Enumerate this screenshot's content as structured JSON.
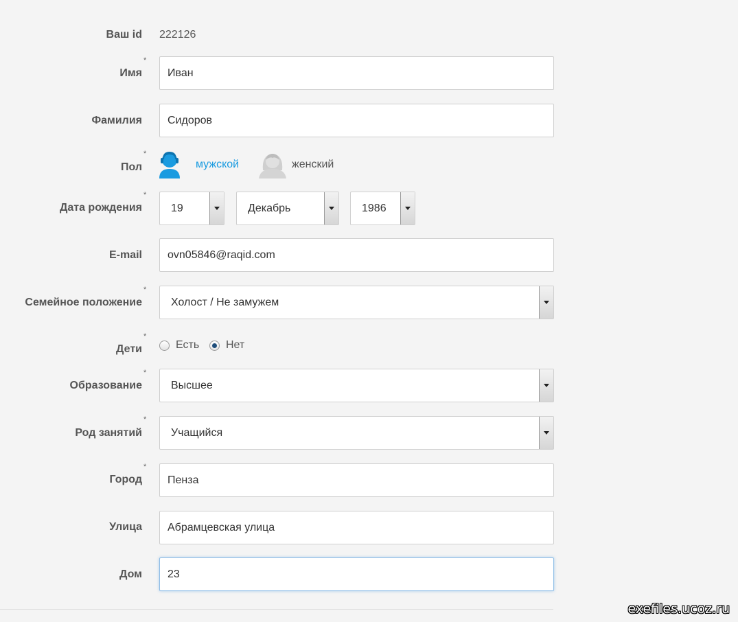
{
  "form": {
    "id_label": "Ваш id",
    "id_value": "222126",
    "first_name": {
      "label": "Имя",
      "value": "Иван",
      "required": "*"
    },
    "last_name": {
      "label": "Фамилия",
      "value": "Сидоров"
    },
    "gender": {
      "label": "Пол",
      "required": "*",
      "male_label": "мужской",
      "female_label": "женский",
      "selected": "male",
      "selected_color": "#1a9be0",
      "unselected_color": "#cccccc"
    },
    "birth_date": {
      "label": "Дата рождения",
      "required": "*",
      "day": "19",
      "month": "Декабрь",
      "year": "1986"
    },
    "email": {
      "label": "E-mail",
      "value": "ovn05846@raqid.com"
    },
    "marital_status": {
      "label": "Семейное положение",
      "required": "*",
      "value": "Холост / Не замужем"
    },
    "children": {
      "label": "Дети",
      "required": "*",
      "option_yes": "Есть",
      "option_no": "Нет",
      "selected": "no"
    },
    "education": {
      "label": "Образование",
      "required": "*",
      "value": "Высшее"
    },
    "occupation": {
      "label": "Род занятий",
      "required": "*",
      "value": "Учащийся"
    },
    "city": {
      "label": "Город",
      "required": "*",
      "value": "Пенза"
    },
    "street": {
      "label": "Улица",
      "value": "Абрамцевская улица"
    },
    "house": {
      "label": "Дом",
      "value": "23"
    }
  },
  "watermark": "exefiles.ucoz.ru"
}
